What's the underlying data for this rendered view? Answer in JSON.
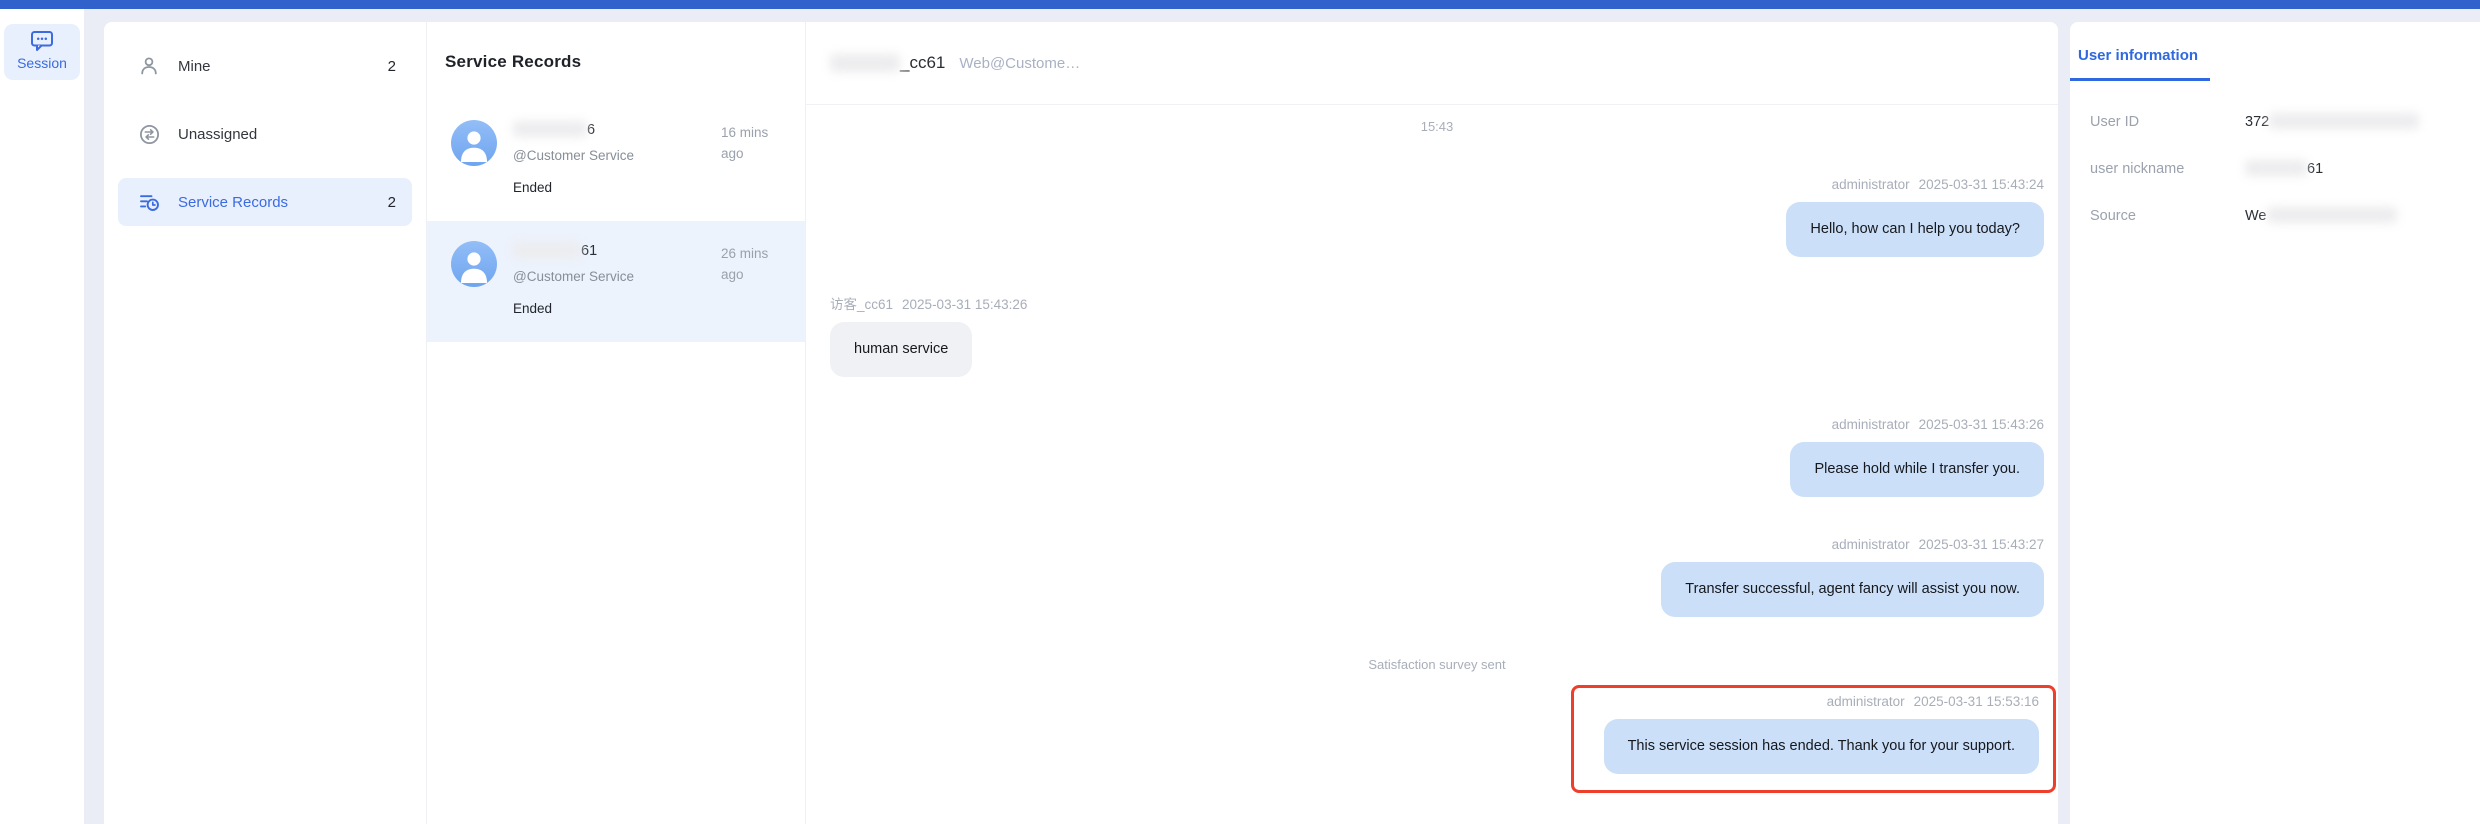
{
  "colors": {
    "topbar": "#3161cb",
    "accent_blue": "#3a6be0",
    "tab_blue": "#2f68df",
    "selected_nav_bg": "#e9f0fd",
    "selected_record_bg": "#edf3fd",
    "agent_bubble": "#cbdff8",
    "visitor_bubble": "#f0f1f4",
    "highlight_border_red": "#ee3f2d",
    "avatar_blue": "#7fb0f2",
    "page_background": "#eaedf5"
  },
  "rail": {
    "session": "Session"
  },
  "nav": {
    "items": [
      {
        "label": "Mine",
        "count": "2",
        "selected": false
      },
      {
        "label": "Unassigned",
        "count": "",
        "selected": false
      },
      {
        "label": "Service Records",
        "count": "2",
        "selected": true
      }
    ]
  },
  "records": {
    "title": "Service Records",
    "items": [
      {
        "name_visible": "6",
        "subtitle": "@Customer Service",
        "status": "Ended",
        "time": "16 mins ago",
        "selected": false
      },
      {
        "name_visible": "61",
        "subtitle": "@Customer Service",
        "status": "Ended",
        "time": "26 mins ago",
        "selected": true
      }
    ]
  },
  "chat": {
    "header": {
      "name_visible": "_cc61",
      "channel": "Web@Custome…"
    },
    "session_time": "15:43",
    "messages": [
      {
        "side": "right",
        "author": "administrator",
        "time": "2025-03-31 15:43:24",
        "text": "Hello, how can I help you today?"
      },
      {
        "side": "left",
        "author": "访客_cc61",
        "time": "2025-03-31 15:43:26",
        "text": "human service"
      },
      {
        "side": "right",
        "author": "administrator",
        "time": "2025-03-31 15:43:26",
        "text": "Please hold while I transfer you."
      },
      {
        "side": "right",
        "author": "administrator",
        "time": "2025-03-31 15:43:27",
        "text": "Transfer successful, agent fancy will assist you now."
      }
    ],
    "system_notice": "Satisfaction survey sent",
    "highlighted_message": {
      "author": "administrator",
      "time": "2025-03-31 15:53:16",
      "text": "This service session has ended. Thank you for your support."
    }
  },
  "user_info": {
    "tab": "User information",
    "rows": [
      {
        "label": "User ID",
        "value_visible": "372"
      },
      {
        "label": "user nickname",
        "value_visible": "61"
      },
      {
        "label": "Source",
        "value_visible": "We"
      }
    ]
  }
}
